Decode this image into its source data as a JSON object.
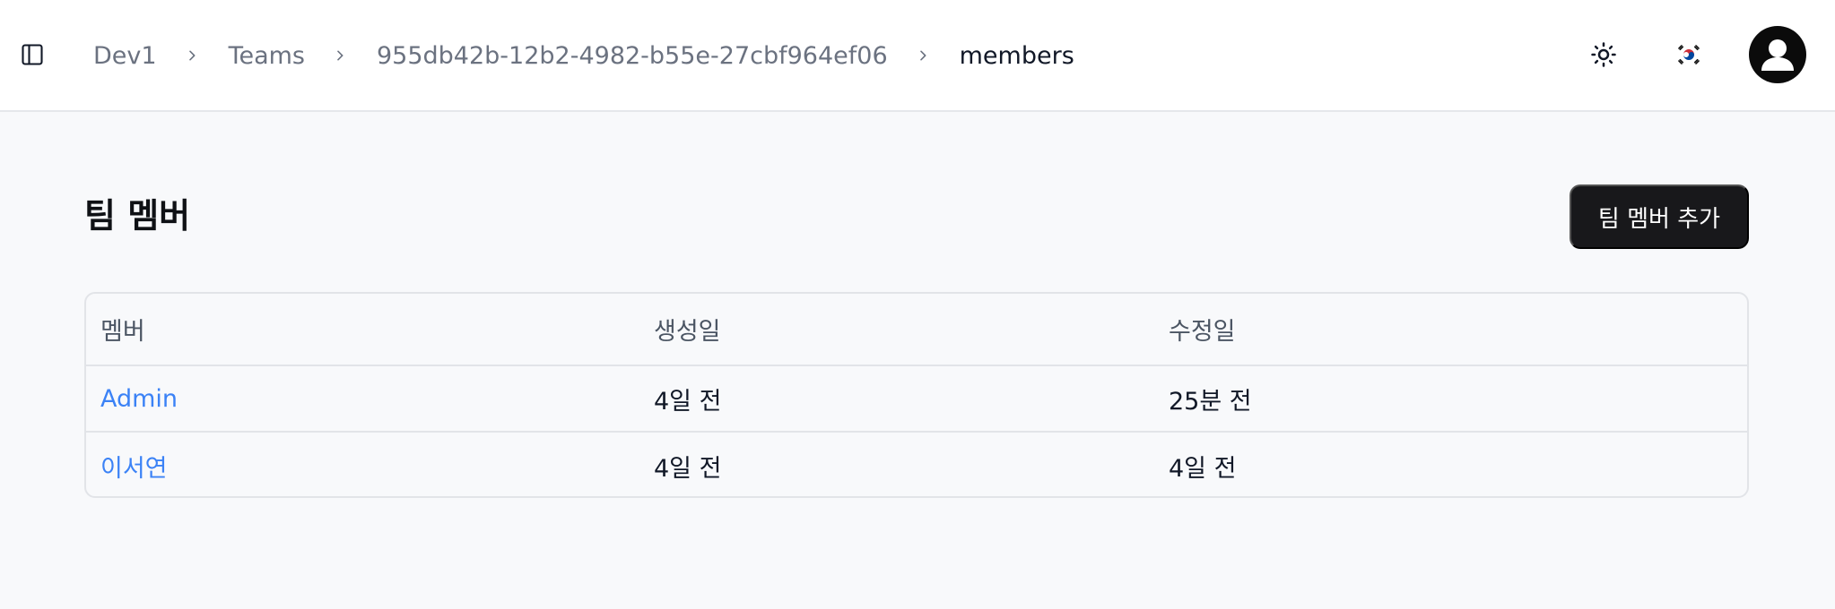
{
  "breadcrumb": [
    {
      "label": "Dev1"
    },
    {
      "label": "Teams"
    },
    {
      "label": "955db42b-12b2-4982-b55e-27cbf964ef06"
    },
    {
      "label": "members"
    }
  ],
  "header": {
    "sidebar_toggle_icon": "panel-left-icon",
    "theme_icon": "sun-icon",
    "language_icon": "korea-flag-icon",
    "avatar_icon": "user-icon"
  },
  "main": {
    "title": "팀 멤버",
    "add_button_label": "팀 멤버 추가"
  },
  "table": {
    "columns": [
      "멤버",
      "생성일",
      "수정일"
    ],
    "rows": [
      {
        "member": "Admin",
        "created": "4일 전",
        "updated": "25분 전"
      },
      {
        "member": "이서연",
        "created": "4일 전",
        "updated": "4일 전"
      }
    ]
  },
  "colors": {
    "link": "#3b82f6",
    "button_bg": "#18181b",
    "page_bg": "#f8f9fb"
  }
}
